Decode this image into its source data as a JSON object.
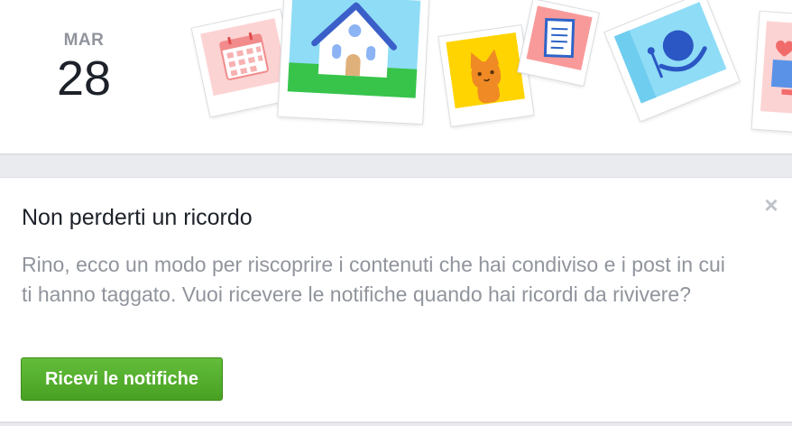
{
  "header": {
    "month": "MAR",
    "day": "28",
    "illustrations": [
      "calendar-icon",
      "house-icon",
      "cat-icon",
      "notebook-icon",
      "person-icon",
      "heart-icon"
    ]
  },
  "card": {
    "title": "Non perderti un ricordo",
    "body": "Rino, ecco un modo per riscoprire i contenuti che hai condiviso e i post in cui ti hanno taggato. Vuoi ricevere le notifiche quando hai ricordi da rivivere?",
    "button_label": "Ricevi le notifiche",
    "close_label": "×"
  },
  "colors": {
    "page_background": "#e9ebee",
    "title_text": "#1d2129",
    "body_text": "#90949c",
    "button_green": "#5bb234"
  }
}
